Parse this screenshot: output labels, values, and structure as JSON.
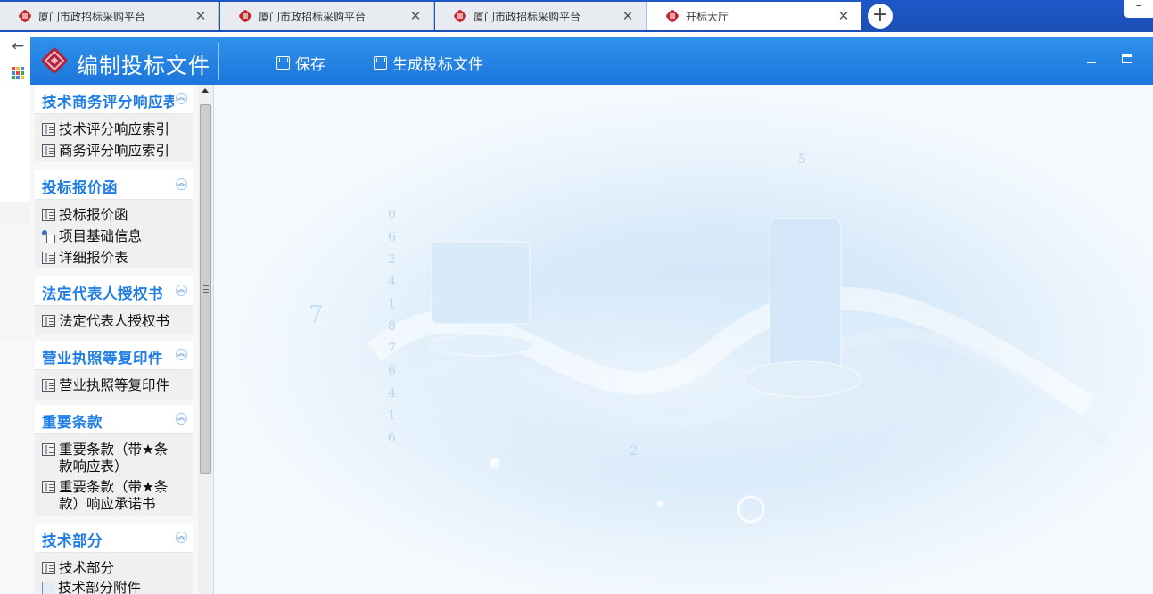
{
  "browser": {
    "tabs": [
      {
        "title": "厦门市政招标采购平台",
        "active": false
      },
      {
        "title": "厦门市政招标采购平台",
        "active": false
      },
      {
        "title": "厦门市政招标采购平台",
        "active": false
      },
      {
        "title": "开标大厅",
        "active": true
      }
    ],
    "new_tab_label": "+",
    "close_label": "✕",
    "back_label": "←",
    "window_min_label": "–"
  },
  "app": {
    "title": "编制投标文件",
    "toolbar": {
      "save_label": "保存",
      "generate_label": "生成投标文件"
    },
    "accent_color": "#1e7de6",
    "header_color": "#2a8ae6"
  },
  "sidebar": {
    "groups": [
      {
        "title": "技术商务评分响应表",
        "items": [
          {
            "label": "技术评分响应索引",
            "icon": "document-icon"
          },
          {
            "label": "商务评分响应索引",
            "icon": "document-icon"
          }
        ]
      },
      {
        "title": "投标报价函",
        "items": [
          {
            "label": "投标报价函",
            "icon": "document-icon"
          },
          {
            "label": "项目基础信息",
            "icon": "info-form-icon"
          },
          {
            "label": "详细报价表",
            "icon": "document-icon"
          }
        ]
      },
      {
        "title": "法定代表人授权书",
        "items": [
          {
            "label": "法定代表人授权书",
            "icon": "document-icon"
          }
        ]
      },
      {
        "title": "营业执照等复印件",
        "items": [
          {
            "label": "营业执照等复印件",
            "icon": "document-icon"
          }
        ]
      },
      {
        "title": "重要条款",
        "items": [
          {
            "label": "重要条款（带★条款响应表）",
            "icon": "document-icon"
          },
          {
            "label": "重要条款（带★条款）响应承诺书",
            "icon": "document-icon"
          }
        ]
      },
      {
        "title": "技术部分",
        "items": [
          {
            "label": "技术部分",
            "icon": "document-icon"
          },
          {
            "label": "技术部分附件",
            "icon": "attachment-icon"
          }
        ]
      }
    ],
    "collapse_glyph": "︽"
  }
}
